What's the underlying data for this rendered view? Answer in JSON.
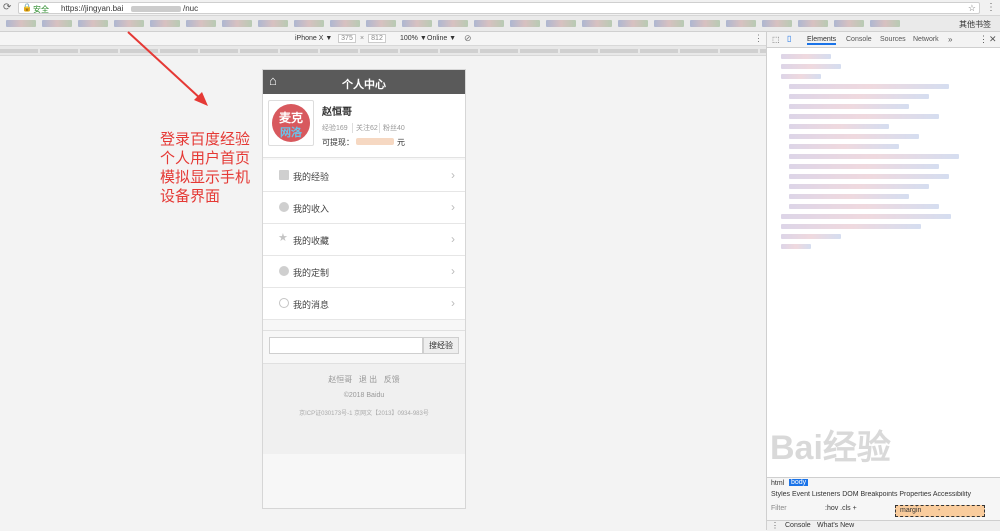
{
  "browser": {
    "secure_label": "安全",
    "url": "https://jingyan.bai",
    "url_tail": "/nuc",
    "bookmark_other": "其他书签"
  },
  "device_toolbar": {
    "device": "iPhone X ▼",
    "width": "375",
    "x": "×",
    "height": "812",
    "zoom": "100% ▼",
    "network": "Online ▼"
  },
  "phone": {
    "header_title": "个人中心",
    "user": {
      "name": "赵恒哥",
      "stats": [
        "经验169",
        "关注62",
        "粉丝40"
      ],
      "withdraw_label": "可提现：",
      "withdraw_suffix": "元",
      "avatar_text_1": "麦克",
      "avatar_text_2": "网洛"
    },
    "menu": [
      {
        "label": "我的经验"
      },
      {
        "label": "我的收入"
      },
      {
        "label": "我的收藏"
      },
      {
        "label": "我的定制"
      },
      {
        "label": "我的消息"
      }
    ],
    "search": {
      "button": "搜经验",
      "placeholder": ""
    },
    "footer": {
      "links": [
        "赵恒哥",
        "退 出",
        "反馈"
      ],
      "copyright": "©2018 Baidu",
      "icp": "京ICP证030173号-1 京网文【2013】0934-983号"
    }
  },
  "annotation": {
    "lines": [
      "登录百度经验",
      "个人用户首页",
      "模拟显示手机",
      "设备界面"
    ]
  },
  "devtools": {
    "tabs": [
      "Elements",
      "Console",
      "Sources",
      "Network",
      "»"
    ],
    "breadcrumb": [
      "html",
      "body"
    ],
    "styles_tabs": "Styles  Event Listeners  DOM Breakpoints  Properties  Accessibility",
    "filter_label": "Filter",
    "filter_tools": ":hov  .cls  +",
    "margin_label": "margin",
    "margin_value": "-",
    "drawer_tabs": [
      "Console",
      "What's New"
    ]
  },
  "watermark": "Bai经验",
  "colors": {
    "annotation": "#e53935",
    "header": "#5a5a5a"
  }
}
